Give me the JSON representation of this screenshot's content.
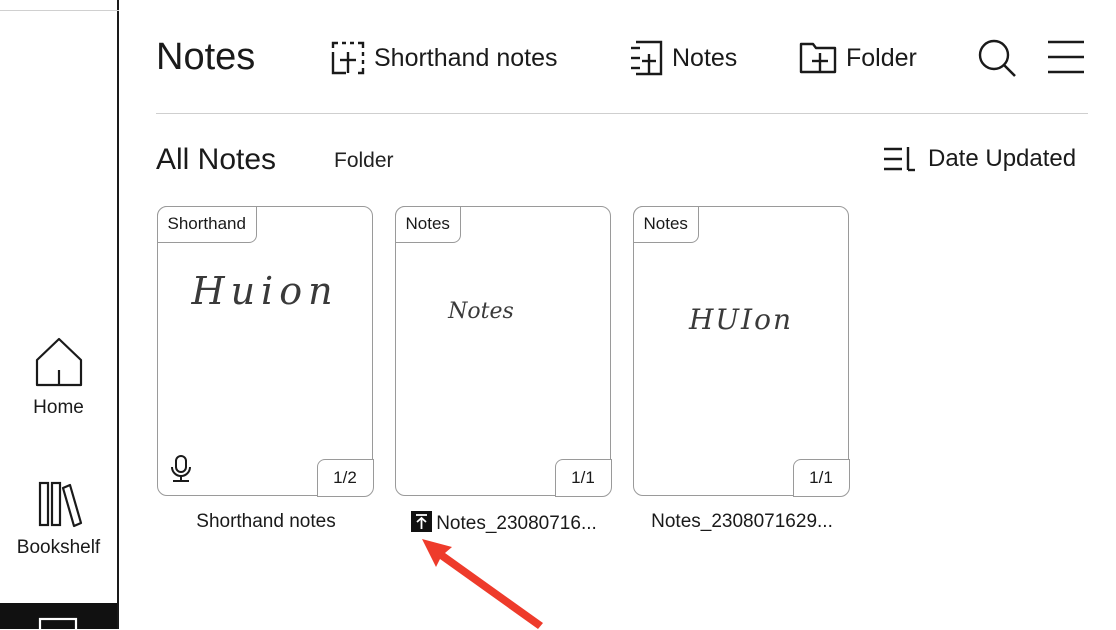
{
  "header": {
    "title": "Notes",
    "shorthand_label": "Shorthand notes",
    "notes_label": "Notes",
    "folder_label": "Folder"
  },
  "filters": {
    "all_notes": "All Notes",
    "folder": "Folder",
    "sort_label": "Date Updated"
  },
  "sidebar": {
    "home": "Home",
    "bookshelf": "Bookshelf"
  },
  "notes": [
    {
      "type": "Shorthand",
      "handwriting": "Huion",
      "pages": "1/2",
      "name": "Shorthand notes",
      "has_audio": true,
      "pinned": false
    },
    {
      "type": "Notes",
      "handwriting": "Notes",
      "pages": "1/1",
      "name": "Notes_23080716...",
      "has_audio": false,
      "pinned": true
    },
    {
      "type": "Notes",
      "handwriting": "HUIon",
      "pages": "1/1",
      "name": "Notes_2308071629...",
      "has_audio": false,
      "pinned": false
    }
  ],
  "icons": {
    "pin": "pin-to-top-icon",
    "annotation": "red-arrow"
  },
  "colors": {
    "annotation_arrow": "#ee3b2b",
    "active_nav": "#111111"
  }
}
